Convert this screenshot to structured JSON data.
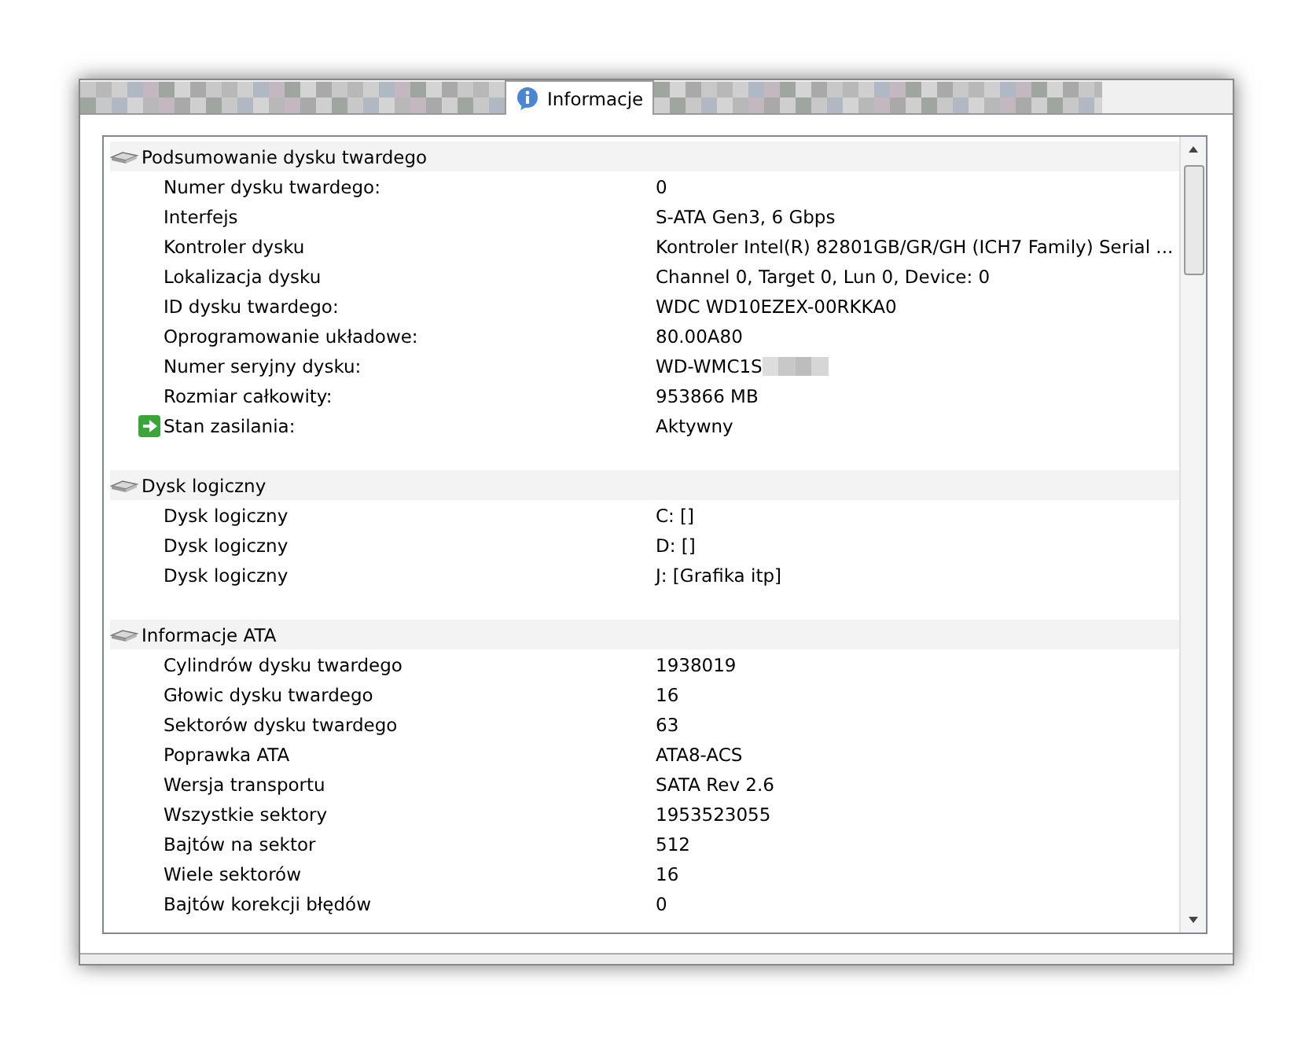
{
  "tabs": [
    {
      "label": "Informacje",
      "selected": true
    }
  ],
  "sections": [
    {
      "title": "Podsumowanie dysku twardego",
      "rows": [
        {
          "label": "Numer dysku twardego:",
          "value": "0"
        },
        {
          "label": "Interfejs",
          "value": "S-ATA Gen3, 6 Gbps"
        },
        {
          "label": "Kontroler dysku",
          "value": "Kontroler Intel(R) 82801GB/GR/GH (ICH7 Family) Serial ..."
        },
        {
          "label": "Lokalizacja dysku",
          "value": "Channel 0, Target 0, Lun 0, Device: 0"
        },
        {
          "label": "ID dysku twardego:",
          "value": "WDC WD10EZEX-00RKKA0"
        },
        {
          "label": "Oprogramowanie układowe:",
          "value": "80.00A80"
        },
        {
          "label": "Numer seryjny dysku:",
          "value": "WD-WMC1S",
          "kind": "redacted"
        },
        {
          "label": "Rozmiar całkowity:",
          "value": "953866 MB"
        },
        {
          "label": "Stan zasilania:",
          "value": "Aktywny",
          "kind": "status"
        }
      ]
    },
    {
      "title": "Dysk logiczny",
      "rows": [
        {
          "label": "Dysk logiczny",
          "value": "C: []"
        },
        {
          "label": "Dysk logiczny",
          "value": "D: []"
        },
        {
          "label": "Dysk logiczny",
          "value": "J: [Grafika itp]"
        }
      ]
    },
    {
      "title": "Informacje ATA",
      "rows": [
        {
          "label": "Cylindrów dysku twardego",
          "value": "1938019"
        },
        {
          "label": "Głowic dysku twardego",
          "value": "16"
        },
        {
          "label": "Sektorów dysku twardego",
          "value": "63"
        },
        {
          "label": "Poprawka ATA",
          "value": "ATA8-ACS"
        },
        {
          "label": "Wersja transportu",
          "value": "SATA Rev 2.6"
        },
        {
          "label": "Wszystkie sektory",
          "value": "1953523055"
        },
        {
          "label": "Bajtów na sektor",
          "value": "512"
        },
        {
          "label": "Wiele sektorów",
          "value": "16"
        },
        {
          "label": "Bajtów korekcji błędów",
          "value": "0"
        }
      ]
    }
  ]
}
